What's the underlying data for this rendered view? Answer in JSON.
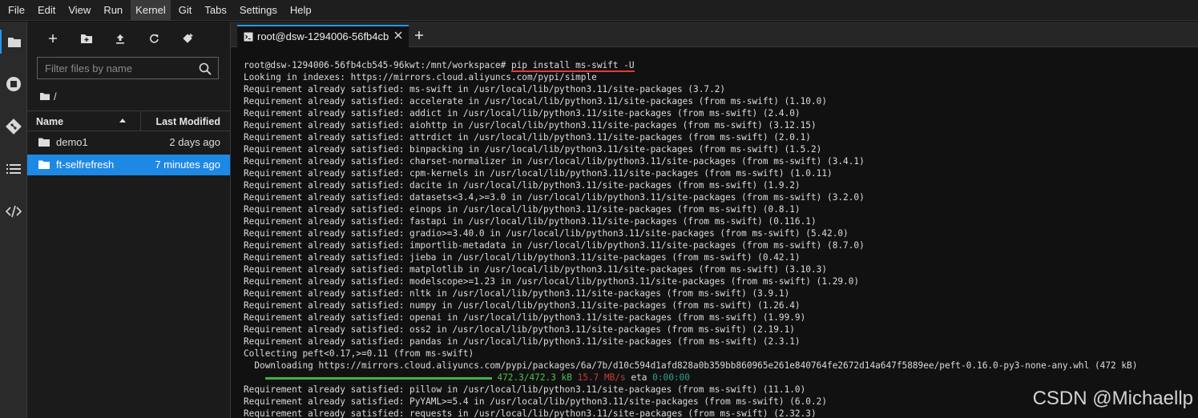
{
  "menu": [
    "File",
    "Edit",
    "View",
    "Run",
    "Kernel",
    "Git",
    "Tabs",
    "Settings",
    "Help"
  ],
  "menu_active_index": 4,
  "rail": {
    "icons": [
      "folder-icon",
      "running-icon",
      "git-icon",
      "toc-icon",
      "extension-icon"
    ]
  },
  "file_browser": {
    "toolbar": [
      "new-launcher-icon",
      "new-folder-icon",
      "upload-icon",
      "refresh-icon",
      "git-clone-icon"
    ],
    "filter_placeholder": "Filter files by name",
    "breadcrumb": "/",
    "columns": {
      "name": "Name",
      "modified": "Last Modified"
    },
    "files": [
      {
        "name": "demo1",
        "modified": "2 days ago",
        "selected": false
      },
      {
        "name": "ft-selfrefresh",
        "modified": "7 minutes ago",
        "selected": true
      }
    ]
  },
  "tab": {
    "label": "root@dsw-1294006-56fb4cb",
    "add_label": "+"
  },
  "terminal": {
    "prompt": "root@dsw-1294006-56fb4cb545-96kwt:/mnt/workspace# ",
    "command": "pip install ms-swift -U",
    "lines": [
      "Looking in indexes: https://mirrors.cloud.aliyuncs.com/pypi/simple",
      "Requirement already satisfied: ms-swift in /usr/local/lib/python3.11/site-packages (3.7.2)",
      "Requirement already satisfied: accelerate in /usr/local/lib/python3.11/site-packages (from ms-swift) (1.10.0)",
      "Requirement already satisfied: addict in /usr/local/lib/python3.11/site-packages (from ms-swift) (2.4.0)",
      "Requirement already satisfied: aiohttp in /usr/local/lib/python3.11/site-packages (from ms-swift) (3.12.15)",
      "Requirement already satisfied: attrdict in /usr/local/lib/python3.11/site-packages (from ms-swift) (2.0.1)",
      "Requirement already satisfied: binpacking in /usr/local/lib/python3.11/site-packages (from ms-swift) (1.5.2)",
      "Requirement already satisfied: charset-normalizer in /usr/local/lib/python3.11/site-packages (from ms-swift) (3.4.1)",
      "Requirement already satisfied: cpm-kernels in /usr/local/lib/python3.11/site-packages (from ms-swift) (1.0.11)",
      "Requirement already satisfied: dacite in /usr/local/lib/python3.11/site-packages (from ms-swift) (1.9.2)",
      "Requirement already satisfied: datasets<3.4,>=3.0 in /usr/local/lib/python3.11/site-packages (from ms-swift) (3.2.0)",
      "Requirement already satisfied: einops in /usr/local/lib/python3.11/site-packages (from ms-swift) (0.8.1)",
      "Requirement already satisfied: fastapi in /usr/local/lib/python3.11/site-packages (from ms-swift) (0.116.1)",
      "Requirement already satisfied: gradio>=3.40.0 in /usr/local/lib/python3.11/site-packages (from ms-swift) (5.42.0)",
      "Requirement already satisfied: importlib-metadata in /usr/local/lib/python3.11/site-packages (from ms-swift) (8.7.0)",
      "Requirement already satisfied: jieba in /usr/local/lib/python3.11/site-packages (from ms-swift) (0.42.1)",
      "Requirement already satisfied: matplotlib in /usr/local/lib/python3.11/site-packages (from ms-swift) (3.10.3)",
      "Requirement already satisfied: modelscope>=1.23 in /usr/local/lib/python3.11/site-packages (from ms-swift) (1.29.0)",
      "Requirement already satisfied: nltk in /usr/local/lib/python3.11/site-packages (from ms-swift) (3.9.1)",
      "Requirement already satisfied: numpy in /usr/local/lib/python3.11/site-packages (from ms-swift) (1.26.4)",
      "Requirement already satisfied: openai in /usr/local/lib/python3.11/site-packages (from ms-swift) (1.99.9)",
      "Requirement already satisfied: oss2 in /usr/local/lib/python3.11/site-packages (from ms-swift) (2.19.1)",
      "Requirement already satisfied: pandas in /usr/local/lib/python3.11/site-packages (from ms-swift) (2.3.1)",
      "Collecting peft<0.17,>=0.11 (from ms-swift)",
      "  Downloading https://mirrors.cloud.aliyuncs.com/pypi/packages/6a/7b/d10c594d1afd828a0b359bb860965e261e840764fe2672d14a647f5889ee/peft-0.16.0-py3-none-any.whl (472 kB)"
    ],
    "progress": {
      "fraction": 1.0,
      "size_text": "472.3/472.3 kB",
      "speed_text": "15.7 MB/s",
      "eta_label": "eta",
      "eta_value": "0:00:00"
    },
    "lines_after": [
      "Requirement already satisfied: pillow in /usr/local/lib/python3.11/site-packages (from ms-swift) (11.1.0)",
      "Requirement already satisfied: PyYAML>=5.4 in /usr/local/lib/python3.11/site-packages (from ms-swift) (6.0.2)",
      "Requirement already satisfied: requests in /usr/local/lib/python3.11/site-packages (from ms-swift) (2.32.3)"
    ]
  },
  "watermark": "CSDN @Michaellp",
  "colors": {
    "accent": "#2196f3",
    "selected_row": "#1e88e5",
    "progress": "#3ab54a",
    "speed": "#c43c3c",
    "eta": "#2aa198",
    "command_underline": "#e23b3b"
  }
}
